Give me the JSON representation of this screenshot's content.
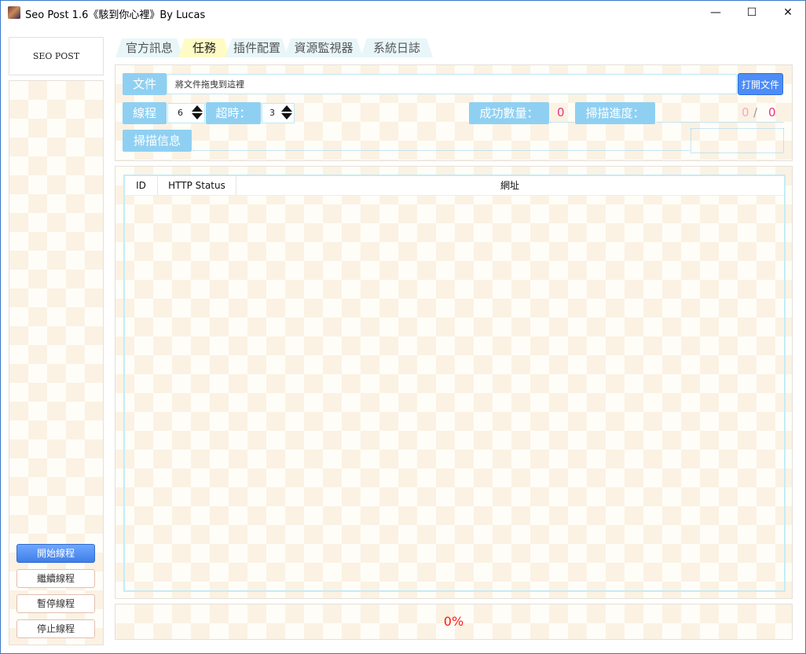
{
  "window": {
    "title": "Seo Post 1.6《駭到你心裡》By Lucas",
    "minimize": "—",
    "maximize": "☐",
    "close": "✕"
  },
  "sidebar": {
    "logo_text": "SEO POST",
    "buttons": [
      {
        "label": "開始線程"
      },
      {
        "label": "繼續線程"
      },
      {
        "label": "暫停線程"
      },
      {
        "label": "停止線程"
      }
    ]
  },
  "tabs": [
    {
      "label": "官方訊息"
    },
    {
      "label": "任務"
    },
    {
      "label": "插件配置"
    },
    {
      "label": "資源監視器"
    },
    {
      "label": "系統日誌"
    }
  ],
  "task": {
    "file_label": "文件",
    "file_placeholder": "將文件拖曳到這裡",
    "open_file_button": "打開文件",
    "threads_label": "線程",
    "threads_value": "6",
    "timeout_label": "超時：",
    "timeout_value": "3",
    "success_label": "成功數量：",
    "success_value": "0",
    "progress_label": "掃描進度：",
    "progress_done": "0",
    "progress_sep": "/",
    "progress_total": "0",
    "scan_info_label": "掃描信息"
  },
  "table": {
    "columns": [
      "ID",
      "HTTP Status",
      "網址"
    ],
    "rows": []
  },
  "status": {
    "percent": "0%"
  },
  "colors": {
    "accent_blue": "#4e8cf6",
    "label_blue": "#8fd0f2",
    "active_tab": "#fffbc4",
    "count_pink": "#e8357a",
    "percent_red": "#ff1a1a"
  }
}
